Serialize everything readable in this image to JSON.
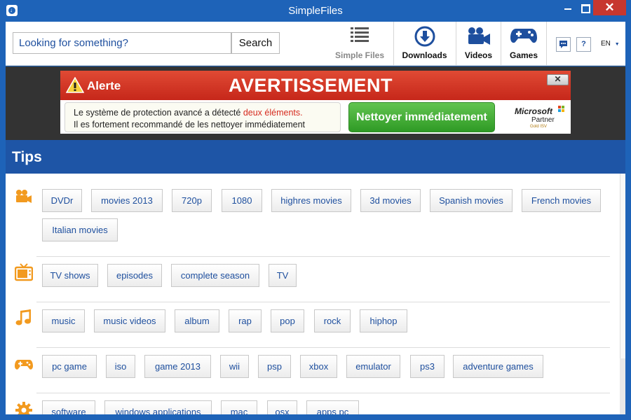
{
  "window": {
    "title": "SimpleFiles",
    "close_glyph": "✕",
    "minimize_icon": "minimize-icon",
    "maximize_icon": "maximize-icon"
  },
  "toolbar": {
    "search_placeholder": "Looking for something?",
    "search_value": "",
    "search_label": "Search",
    "nav": [
      {
        "label": "Simple Files",
        "icon": "list-icon",
        "active": true
      },
      {
        "label": "Downloads",
        "icon": "download-icon"
      },
      {
        "label": "Videos",
        "icon": "video-camera-icon"
      },
      {
        "label": "Games",
        "icon": "gamepad-icon"
      }
    ],
    "chat_icon": "chat-icon",
    "help_label": "?",
    "language": "EN",
    "lang_arrow": "▼"
  },
  "ad": {
    "alert_label": "Alerte",
    "title": "AVERTISSEMENT",
    "close_label": "✕",
    "message_line1_a": "Le système de protection avancé  a détecté",
    "message_line1_b": "deux éléments.",
    "message_line2": "Il es fortement recommandé de les nettoyer immédiatement",
    "cta": "Nettoyer immédiatement",
    "ms_logo": "Microsoft",
    "ms_partner": "Partner",
    "ms_gold": "Gold ISV"
  },
  "tips": {
    "title": "Tips",
    "categories": [
      {
        "icon": "video-camera-icon",
        "tags": [
          "DVDr",
          "movies 2013",
          "720p",
          "1080",
          "highres movies",
          "3d movies",
          "Spanish movies",
          "French movies",
          "Italian movies"
        ]
      },
      {
        "icon": "tv-icon",
        "tags": [
          "TV shows",
          "episodes",
          "complete season",
          "TV"
        ]
      },
      {
        "icon": "music-note-icon",
        "tags": [
          "music",
          "music videos",
          "album",
          "rap",
          "pop",
          "rock",
          "hiphop"
        ]
      },
      {
        "icon": "gamepad-icon",
        "tags": [
          "pc game",
          "iso",
          "game 2013",
          "wii",
          "psp",
          "xbox",
          "emulator",
          "ps3",
          "adventure games"
        ]
      },
      {
        "icon": "gear-icon",
        "tags": [
          "software",
          "windows applications",
          "mac",
          "osx",
          "apps pc"
        ]
      }
    ]
  },
  "colors": {
    "accent": "#1e63b8",
    "tips_bar": "#1e55a6",
    "tag_text": "#1e4f9e",
    "icon_orange": "#f29a1f",
    "alert_red": "#c6271a",
    "cta_green": "#2f9a25"
  }
}
